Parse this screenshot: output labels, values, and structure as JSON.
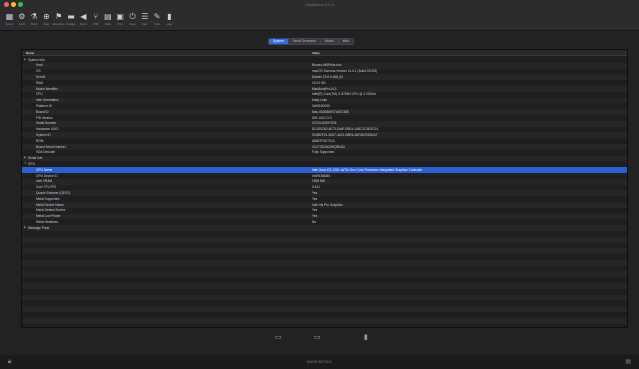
{
  "window": {
    "title": "Hackintool 3.9.4"
  },
  "toolbar": {
    "items": [
      {
        "label": "System",
        "icon": "system-icon",
        "glyph": "▦"
      },
      {
        "label": "Serial",
        "icon": "serial-icon",
        "glyph": "⚙"
      },
      {
        "label": "Patch",
        "icon": "patch-icon",
        "glyph": "⚗"
      },
      {
        "label": "Boot",
        "icon": "boot-icon",
        "glyph": "⊕"
      },
      {
        "label": "Extensions",
        "icon": "extensions-icon",
        "glyph": "⚑"
      },
      {
        "label": "Displays",
        "icon": "displays-icon",
        "glyph": "▬"
      },
      {
        "label": "Sound",
        "icon": "sound-icon",
        "glyph": "◀"
      },
      {
        "label": "USB",
        "icon": "usb-icon",
        "glyph": "⑂"
      },
      {
        "label": "Disks",
        "icon": "disks-icon",
        "glyph": "▤"
      },
      {
        "label": "PCIe",
        "icon": "pcie-icon",
        "glyph": "▣"
      },
      {
        "label": "Power",
        "icon": "power-icon",
        "glyph": "⏻"
      },
      {
        "label": "Calc",
        "icon": "calc-icon",
        "glyph": "☰"
      },
      {
        "label": "Tools",
        "icon": "tools-icon",
        "glyph": "✎"
      },
      {
        "label": "Logs",
        "icon": "logs-icon",
        "glyph": "▮"
      }
    ]
  },
  "tabs": [
    "System",
    "Serial Generator",
    "Model",
    "Misc"
  ],
  "table": {
    "headers": [
      "Name",
      "Value"
    ],
    "rows": [
      {
        "name": "System Info",
        "value": "",
        "level": 0,
        "group": true
      },
      {
        "name": "Host",
        "value": "Bruces-MBP.fritz.box",
        "level": 1
      },
      {
        "name": "OS",
        "value": "macOS Sonoma Version 14.6.1 (Build 23G93)",
        "level": 1
      },
      {
        "name": "Kernel",
        "value": "Darwin 23.6.0 x86_64",
        "level": 1
      },
      {
        "name": "RAM",
        "value": "16.00 GB",
        "level": 1
      },
      {
        "name": "Model Identifier",
        "value": "MacBookPro14,3",
        "level": 1
      },
      {
        "name": "CPU",
        "value": "Intel(R) Core(TM) i7-8750H CPU @ 2.20GHz",
        "level": 1
      },
      {
        "name": "Intel Generation",
        "value": "Kaby Lake",
        "level": 1
      },
      {
        "name": "Platform ID",
        "value": "0x591B0000",
        "level": 1
      },
      {
        "name": "Board ID",
        "value": "Mac-551B86E5744E2388",
        "level": 1
      },
      {
        "name": "FW Version",
        "value": "529.140.2.0.0",
        "level": 1
      },
      {
        "name": "Serial Number",
        "value": "C02XL0GEHTD6",
        "level": 1
      },
      {
        "name": "Hardware UUID",
        "value": "8C4D52B2-6073-5A8F-B9D4-1A8C2D3E9C24",
        "level": 1
      },
      {
        "name": "System ID",
        "value": "9C8B2F41-3D07-4A21-B6E5-4AF5D29D82A7",
        "level": 1
      },
      {
        "name": "ROM",
        "value": "A8667F4E7C1C",
        "level": 1
      },
      {
        "name": "Board Serial Number",
        "value": "C02723204J9HQ9KAD",
        "level": 1
      },
      {
        "name": "VDA Decoder",
        "value": "Fully Supported",
        "level": 1
      },
      {
        "name": "Serial Info",
        "value": "",
        "level": 0,
        "group": true
      },
      {
        "name": "GPU",
        "value": "",
        "level": 0,
        "group": true,
        "open": true
      },
      {
        "name": "GPU Name",
        "value": "Intel Xeon E3-1200 v6/7th Gen Core Processor Integrated Graphics Controller",
        "level": 1,
        "selected": true
      },
      {
        "name": "GPU Device ID",
        "value": "0x591B8086",
        "level": 1
      },
      {
        "name": "Intel VRAM",
        "value": "1536 MB",
        "level": 1
      },
      {
        "name": "Core TFLOPS",
        "value": "0.441",
        "level": 1
      },
      {
        "name": "Quartz Extreme (QE/CI)",
        "value": "Yes",
        "level": 1
      },
      {
        "name": "Metal Supported",
        "value": "Yes",
        "level": 1
      },
      {
        "name": "Metal Device Name",
        "value": "Intel Iris Pro Graphics",
        "level": 1
      },
      {
        "name": "Metal Default Device",
        "value": "Yes",
        "level": 1
      },
      {
        "name": "Metal Low Power",
        "value": "Yes",
        "level": 1
      },
      {
        "name": "Metal Headless",
        "value": "No",
        "level": 1
      },
      {
        "name": "Message Pane",
        "value": "",
        "level": 0,
        "group": true
      }
    ]
  },
  "bottom_controls": [
    {
      "icon": "import-icon",
      "glyph": "▭"
    },
    {
      "icon": "export-icon",
      "glyph": "▭"
    },
    {
      "icon": "trash-icon",
      "glyph": "▮"
    }
  ],
  "statusbar": {
    "text": "HACKINTOOL"
  }
}
